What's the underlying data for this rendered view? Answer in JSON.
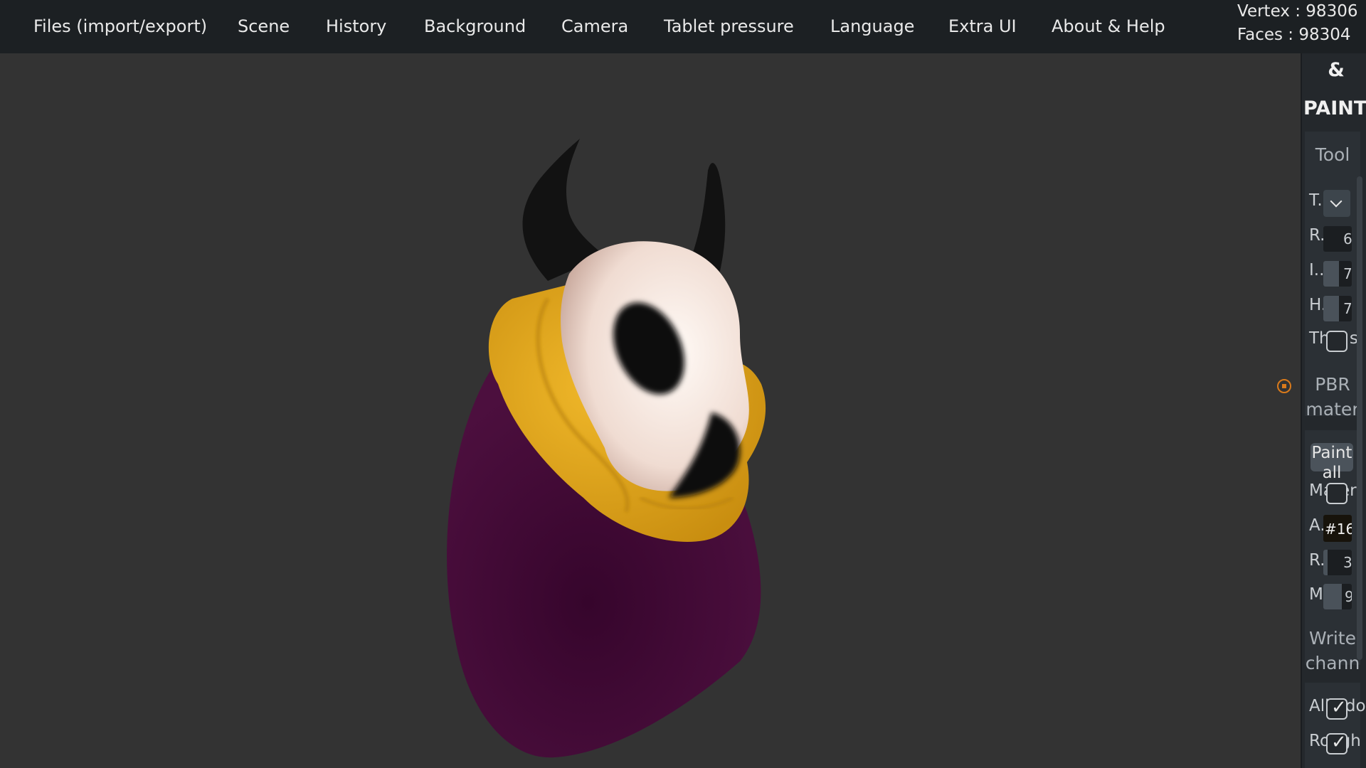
{
  "menu": {
    "items": [
      "Files (import/export)",
      "Scene",
      "History",
      "Background",
      "Camera",
      "Tablet pressure",
      "Language",
      "Extra UI",
      "About & Help"
    ]
  },
  "stats": {
    "vertex": "Vertex : 98306",
    "faces": "Faces : 98304"
  },
  "sidebar": {
    "title_line1": "&",
    "title_line2": "PAINT",
    "tool_heading": "Tool",
    "tool_rows": {
      "tool": "T.",
      "radius": "R.",
      "radius_value": "6",
      "intensity": "I..",
      "intensity_value": "7",
      "hardness": "H.",
      "hardness_value": "7",
      "thin": "Thin s"
    },
    "pbr_heading_1": "PBR",
    "pbr_heading_2": "mater",
    "paint_all_1": "Paint",
    "paint_all_2": "all",
    "material_rows": {
      "material": "Mater",
      "albedo": "A.",
      "albedo_value": "#16",
      "roughness": "R.",
      "roughness_value": "3",
      "metalness": "M",
      "metalness_value": "9"
    },
    "write_heading_1": "Write",
    "write_heading_2": "chann",
    "channels": {
      "albedo": "Albedo",
      "roughness": "Rough"
    }
  },
  "colors": {
    "menubar_bg": "#1c2023",
    "viewport_bg": "#333333",
    "accent_orange": "#d97a1b",
    "model_yellow": "#e0a71a",
    "model_purple": "#3d0a33",
    "model_skull": "#f2e4dc",
    "model_horn": "#111111"
  },
  "icons": {
    "pin": "pin-icon",
    "dropdown": "chevron-down-icon",
    "checkbox": "checkmark-icon"
  }
}
